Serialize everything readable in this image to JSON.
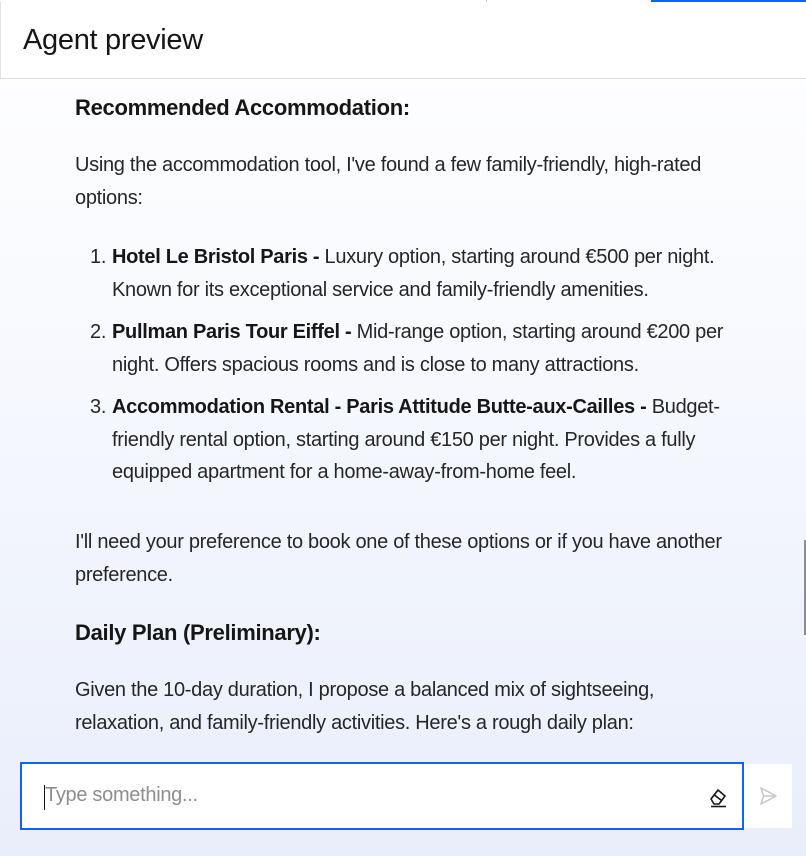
{
  "header": {
    "title": "Agent preview"
  },
  "message": {
    "accommodation_heading": "Recommended Accommodation:",
    "accommodation_intro": "Using the accommodation tool, I've found a few family-friendly, high-rated options:",
    "options": [
      {
        "number": "1.",
        "name": "Hotel Le Bristol Paris -",
        "description": " Luxury option, starting around €500 per night. Known for its exceptional service and family-friendly amenities."
      },
      {
        "number": "2.",
        "name": "Pullman Paris Tour Eiffel -",
        "description": " Mid-range option, starting around €200 per night. Offers spacious rooms and is close to many attractions."
      },
      {
        "number": "3.",
        "name": "Accommodation Rental - Paris Attitude Butte-aux-Cailles -",
        "description": " Budget-friendly rental option, starting around €150 per night. Provides a fully equipped apartment for a home-away-from-home feel."
      }
    ],
    "preference_note": "I'll need your preference to book one of these options or if you have another preference.",
    "daily_plan_heading": "Daily Plan (Preliminary):",
    "daily_plan_intro": "Given the 10-day duration, I propose a balanced mix of sightseeing, relaxation, and family-friendly activities. Here's a rough daily plan:"
  },
  "composer": {
    "placeholder": "Type something...",
    "clear_icon": "eraser-icon",
    "send_icon": "send-icon"
  },
  "colors": {
    "accent": "#0f62fe",
    "text": "#161616",
    "placeholder": "#8d8d8d"
  }
}
